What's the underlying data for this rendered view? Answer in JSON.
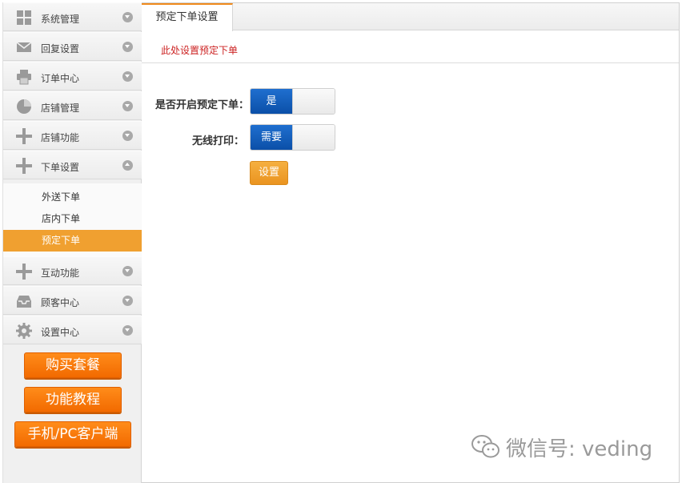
{
  "sidebar": {
    "menu": [
      {
        "label": "系统管理",
        "icon": "grid-icon"
      },
      {
        "label": "回复设置",
        "icon": "envelope-icon"
      },
      {
        "label": "订单中心",
        "icon": "printer-icon"
      },
      {
        "label": "店铺管理",
        "icon": "pie-chart-icon"
      },
      {
        "label": "店铺功能",
        "icon": "plus-icon"
      },
      {
        "label": "下单设置",
        "icon": "plus-icon"
      },
      {
        "label": "互动功能",
        "icon": "plus-icon"
      },
      {
        "label": "顾客中心",
        "icon": "inbox-icon"
      },
      {
        "label": "设置中心",
        "icon": "gear-icon"
      }
    ],
    "submenu": [
      {
        "label": "外送下单"
      },
      {
        "label": "店内下单"
      },
      {
        "label": "预定下单"
      }
    ],
    "promo_buttons": [
      {
        "label": "购买套餐"
      },
      {
        "label": "功能教程"
      },
      {
        "label": "手机/PC客户端"
      }
    ]
  },
  "main": {
    "tab_label": "预定下单设置",
    "hint": "此处设置预定下单",
    "form": {
      "reservation_label": "是否开启预定下单：",
      "reservation_value": "是",
      "wireless_print_label": "无线打印：",
      "wireless_print_value": "需要",
      "save_label": "设置"
    }
  },
  "watermark": {
    "text": "微信号: veding"
  },
  "colors": {
    "accent_orange": "#f0a030",
    "toggle_blue": "#0b4fa8",
    "hint_red": "#cc2222"
  }
}
